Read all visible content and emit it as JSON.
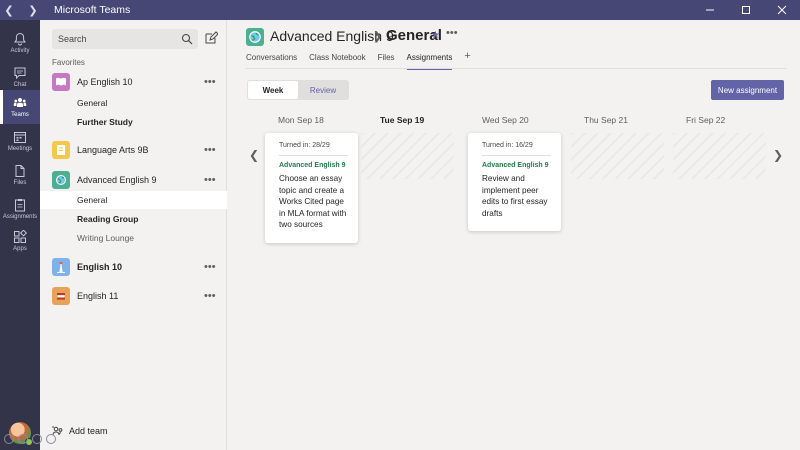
{
  "window": {
    "title": "Microsoft Teams"
  },
  "rail": [
    {
      "label": "Activity",
      "icon": "bell-icon"
    },
    {
      "label": "Chat",
      "icon": "chat-icon"
    },
    {
      "label": "Teams",
      "icon": "teams-icon",
      "active": true
    },
    {
      "label": "Meetings",
      "icon": "calendar-icon"
    },
    {
      "label": "Files",
      "icon": "file-icon"
    },
    {
      "label": "Assignments",
      "icon": "assignment-icon"
    },
    {
      "label": "Apps",
      "icon": "apps-icon"
    }
  ],
  "sidebar": {
    "search_placeholder": "Search",
    "favorites_label": "Favorites",
    "teams": [
      {
        "name": "Ap English 10",
        "tile_color": "#c479c0",
        "channels": [
          "General",
          "Further Study"
        ]
      },
      {
        "name": "Language Arts 9B",
        "tile_color": "#f2c94c"
      },
      {
        "name": "Advanced English 9",
        "tile_color": "#4caf93",
        "channels": [
          "General",
          "Reading Group",
          "Writing Lounge"
        ]
      },
      {
        "name": "English 10",
        "tile_color": "#7fb2e8"
      },
      {
        "name": "English 11",
        "tile_color": "#e8a35a"
      }
    ],
    "add_team_label": "Add team"
  },
  "header": {
    "team_name": "Advanced English 9",
    "channel_name": "General",
    "tabs": [
      "Conversations",
      "Class Notebook",
      "Files",
      "Assignments"
    ]
  },
  "assignments": {
    "toggle": [
      "Week",
      "Review"
    ],
    "new_button": "New assignment",
    "days": [
      {
        "dow": "Mon",
        "date": "Sep 18"
      },
      {
        "dow": "Tue",
        "date": "Sep 19",
        "today": true
      },
      {
        "dow": "Wed",
        "date": "Sep 20"
      },
      {
        "dow": "Thu",
        "date": "Sep 21"
      },
      {
        "dow": "Fri",
        "date": "Sep 22"
      }
    ],
    "cards": [
      {
        "turned_in": "Turned in: 28/29",
        "team": "Advanced English 9",
        "description": "Choose an essay topic and create a Works Cited page in MLA format with two sources"
      },
      {
        "turned_in": "Turned in: 16/29",
        "team": "Advanced English 9",
        "description": "Review and implement peer edits to first essay drafts"
      }
    ]
  },
  "colors": {
    "accent": "#6264a7",
    "titlebar": "#464775",
    "rail": "#33344a",
    "team_label_green": "#237b4b"
  }
}
